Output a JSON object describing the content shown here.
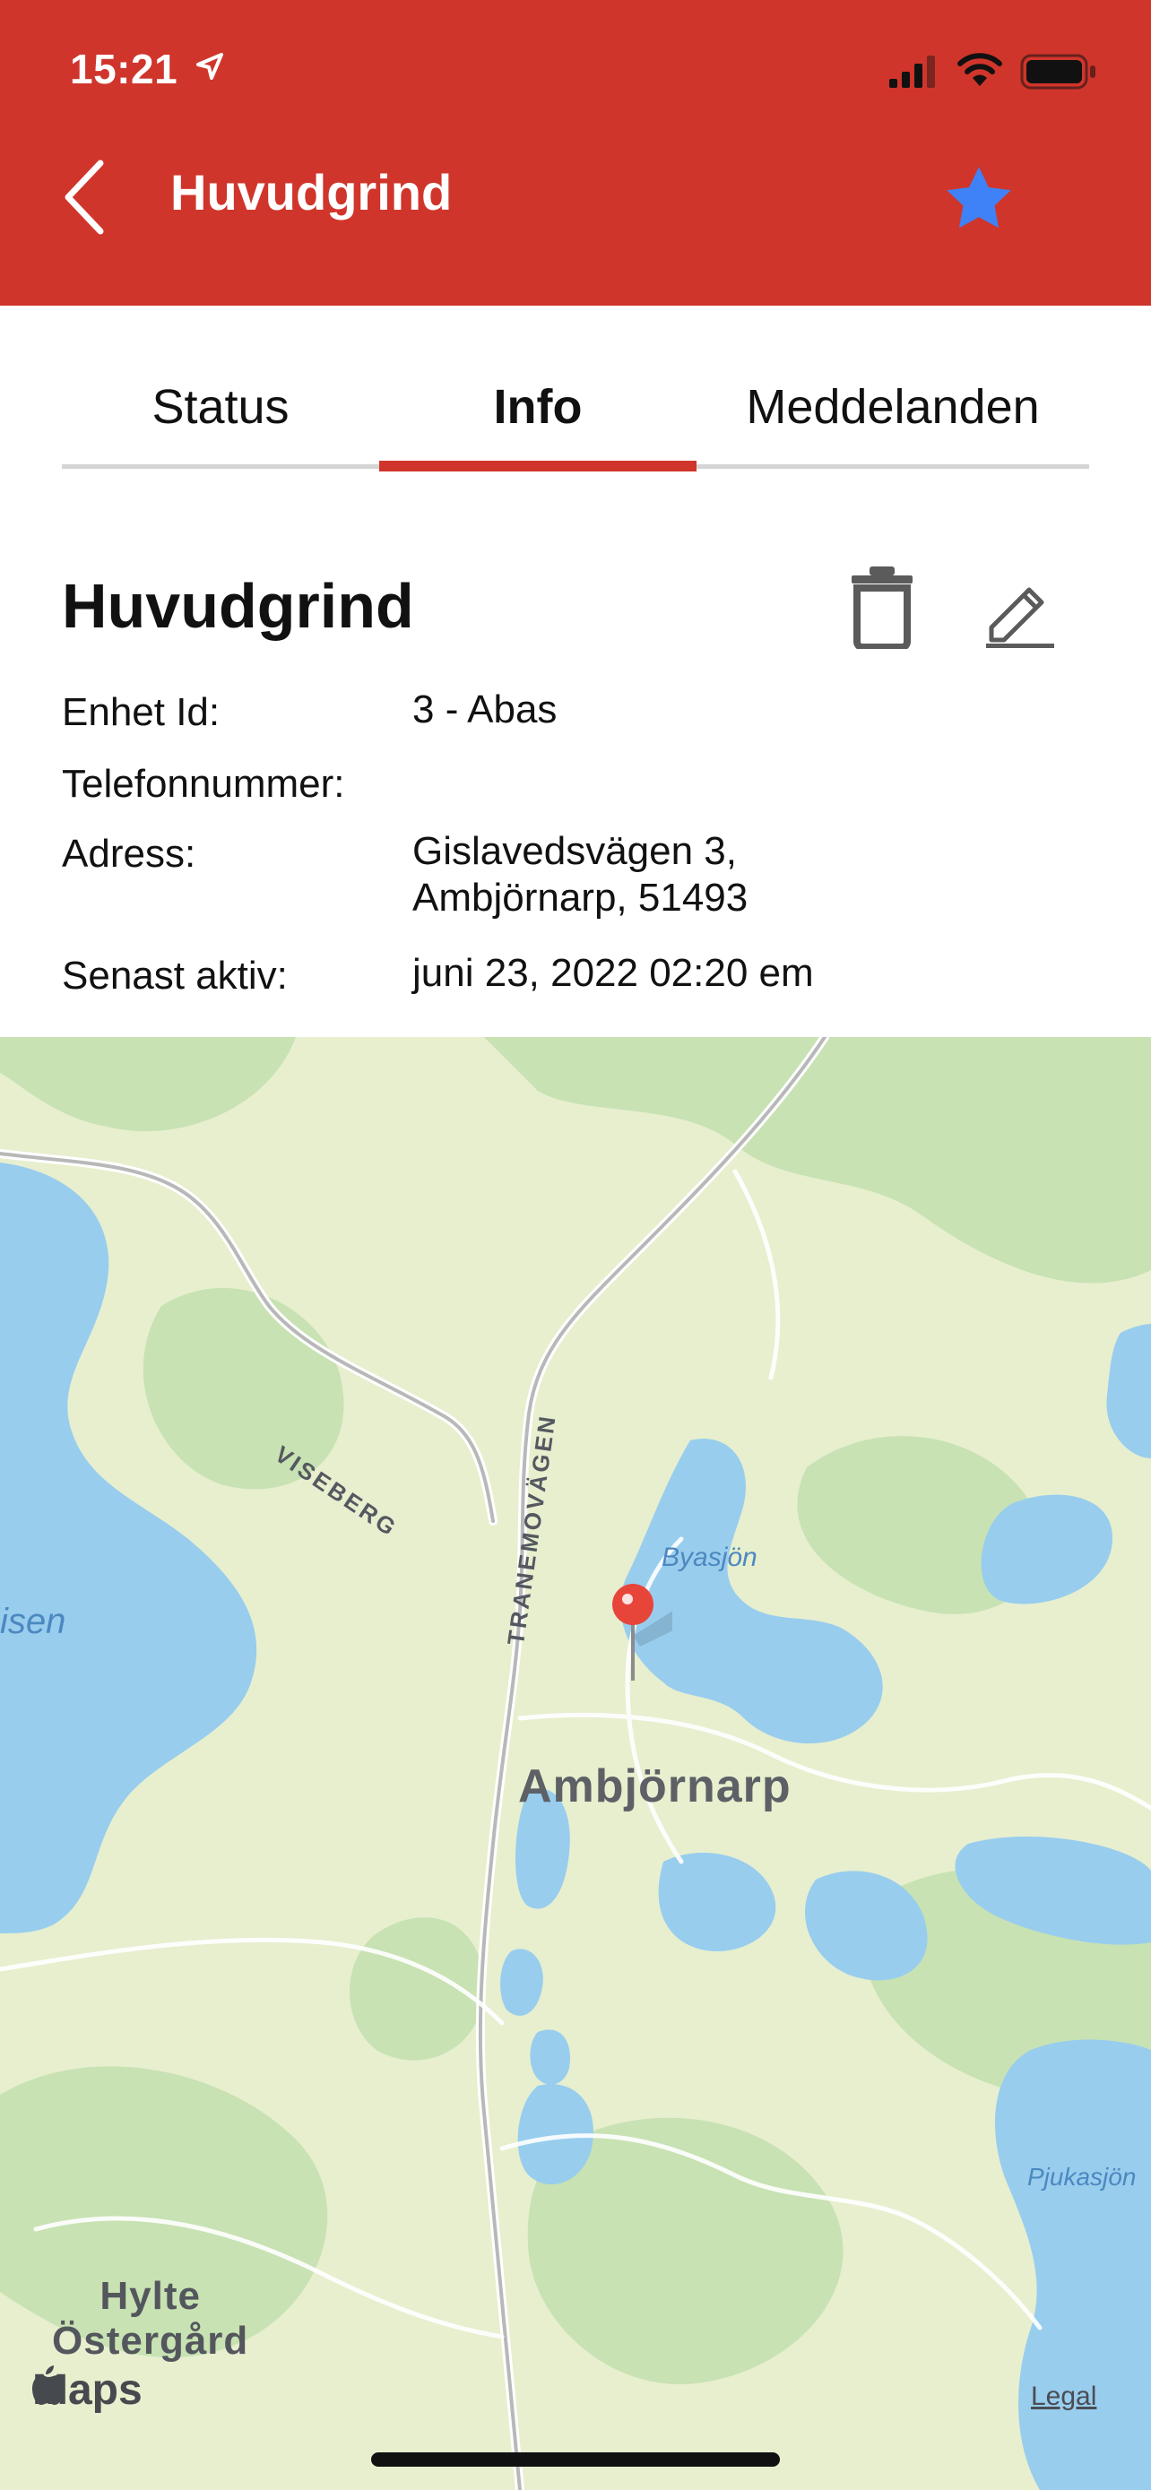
{
  "status_bar": {
    "time": "15:21"
  },
  "header": {
    "title": "Huvudgrind",
    "accent_color": "#d0352b",
    "favorite_color": "#3f82f7"
  },
  "tabs": [
    {
      "label": "Status",
      "selected": false
    },
    {
      "label": "Info",
      "selected": true
    },
    {
      "label": "Meddelanden",
      "selected": false
    }
  ],
  "device": {
    "name": "Huvudgrind",
    "fields": [
      {
        "label": "Enhet Id:",
        "value": "3 - Abas"
      },
      {
        "label": "Telefonnummer:",
        "value": ""
      },
      {
        "label": "Adress:",
        "value_lines": [
          "Gislavedsvägen 3,",
          "Ambjörnarp, 51493"
        ]
      },
      {
        "label": "Senast aktiv:",
        "value": "juni 23, 2022 02:20 em"
      }
    ]
  },
  "map": {
    "labels": {
      "town": "Ambjörnarp",
      "lake_byasjon": "Byasjön",
      "lake_left": "isen",
      "lake_right": "Pjukasjön",
      "road_viseberg": "VISEBERG",
      "road_tranemovagen": "TRANEMOVÄGEN",
      "village_line1": "Hylte",
      "village_line2": "Östergård"
    },
    "brand": "Maps",
    "legal": "Legal"
  }
}
